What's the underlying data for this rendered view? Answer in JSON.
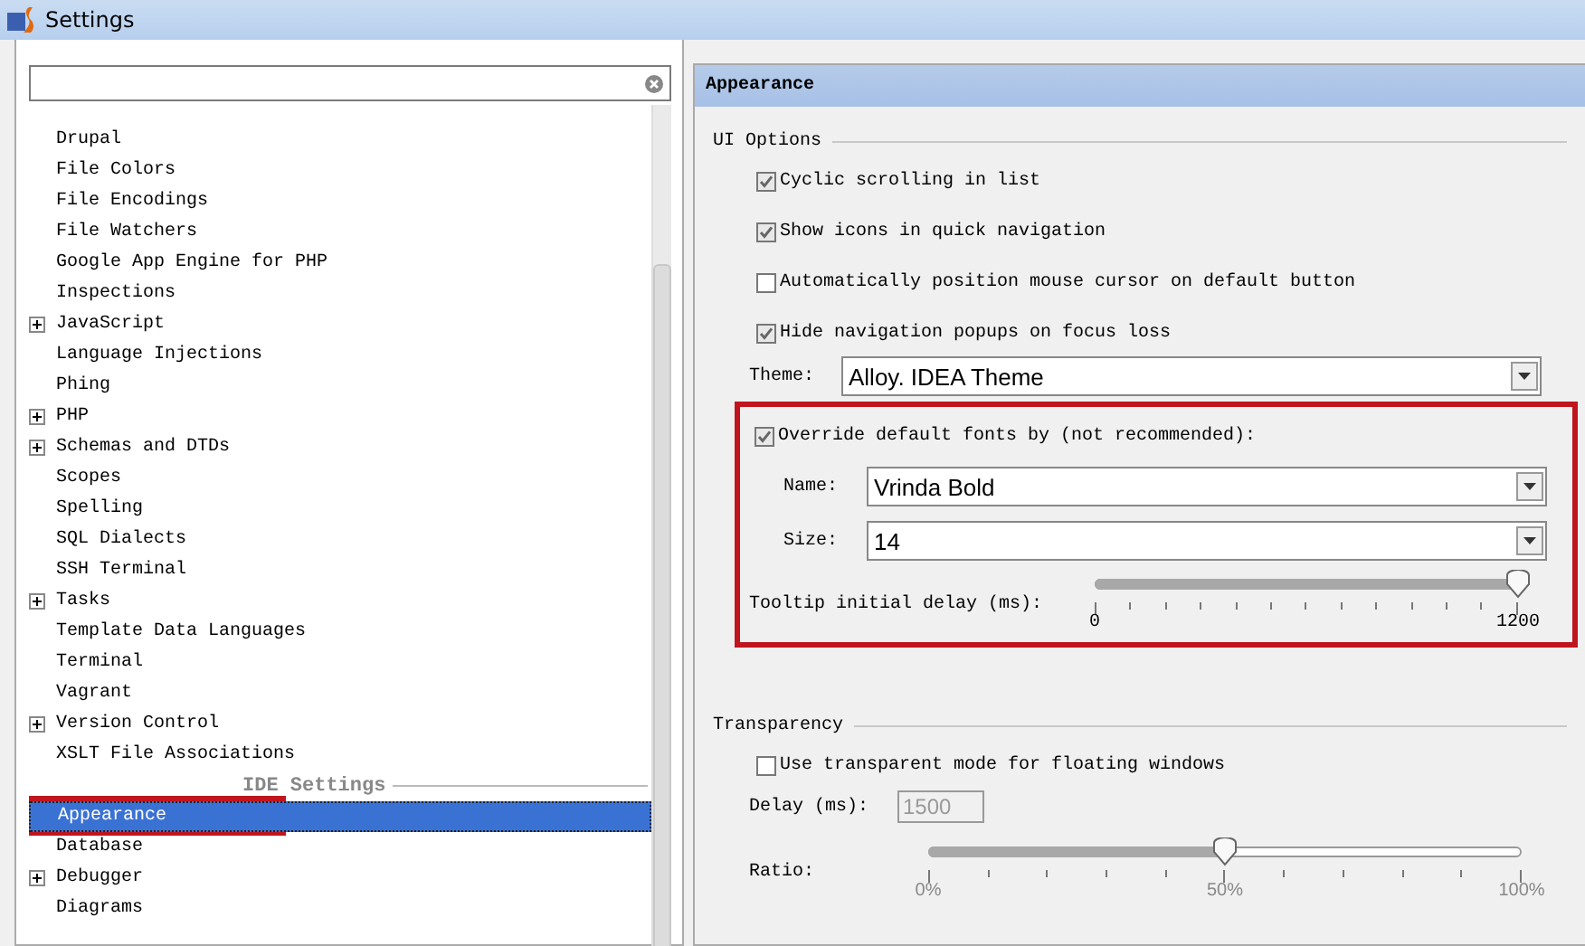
{
  "window": {
    "title": "Settings"
  },
  "tree": {
    "items": [
      {
        "kind": "leaf",
        "label": "Drupal",
        "selected": false
      },
      {
        "kind": "leaf",
        "label": "File Colors",
        "selected": false
      },
      {
        "kind": "leaf",
        "label": "File Encodings",
        "selected": false
      },
      {
        "kind": "leaf",
        "label": "File Watchers",
        "selected": false
      },
      {
        "kind": "leaf",
        "label": "Google App Engine for PHP",
        "selected": false
      },
      {
        "kind": "leaf",
        "label": "Inspections",
        "selected": false
      },
      {
        "kind": "group",
        "label": "JavaScript",
        "expanded": false,
        "selected": false
      },
      {
        "kind": "leaf",
        "label": "Language Injections",
        "selected": false
      },
      {
        "kind": "leaf",
        "label": "Phing",
        "selected": false
      },
      {
        "kind": "group",
        "label": "PHP",
        "expanded": false,
        "selected": false
      },
      {
        "kind": "group",
        "label": "Schemas and DTDs",
        "expanded": false,
        "selected": false
      },
      {
        "kind": "leaf",
        "label": "Scopes",
        "selected": false
      },
      {
        "kind": "leaf",
        "label": "Spelling",
        "selected": false
      },
      {
        "kind": "leaf",
        "label": "SQL Dialects",
        "selected": false
      },
      {
        "kind": "leaf",
        "label": "SSH Terminal",
        "selected": false
      },
      {
        "kind": "group",
        "label": "Tasks",
        "expanded": false,
        "selected": false
      },
      {
        "kind": "leaf",
        "label": "Template Data Languages",
        "selected": false
      },
      {
        "kind": "leaf",
        "label": "Terminal",
        "selected": false
      },
      {
        "kind": "leaf",
        "label": "Vagrant",
        "selected": false
      },
      {
        "kind": "group",
        "label": "Version Control",
        "expanded": false,
        "selected": false
      },
      {
        "kind": "leaf",
        "label": "XSLT File Associations",
        "selected": false
      },
      {
        "kind": "section",
        "label": "IDE Settings"
      },
      {
        "kind": "leaf",
        "label": "Appearance",
        "selected": true
      },
      {
        "kind": "leaf",
        "label": "Database",
        "selected": false
      },
      {
        "kind": "group",
        "label": "Debugger",
        "expanded": false,
        "selected": false
      },
      {
        "kind": "leaf",
        "label": "Diagrams",
        "selected": false
      }
    ]
  },
  "panel": {
    "title": "Appearance",
    "ui_options": {
      "title": "UI Options",
      "checkboxes": [
        {
          "label": "Cyclic scrolling in list",
          "checked": true
        },
        {
          "label": "Show icons in quick navigation",
          "checked": true
        },
        {
          "label": "Automatically position mouse cursor on default button",
          "checked": false
        },
        {
          "label": "Hide navigation popups on focus loss",
          "checked": true
        }
      ],
      "theme": {
        "label": "Theme:",
        "value": "Alloy. IDEA Theme"
      },
      "override": {
        "label": "Override default fonts by (not recommended):",
        "checked": true
      },
      "font_name": {
        "label": "Name:",
        "value": "Vrinda Bold"
      },
      "font_size": {
        "label": "Size:",
        "value": "14"
      },
      "tooltip_delay": {
        "label": "Tooltip initial delay (ms):",
        "level": 1,
        "tick_labels": [
          "0",
          "1200"
        ]
      }
    },
    "transparency": {
      "title": "Transparency",
      "checkbox": {
        "label": "Use transparent mode for floating windows",
        "checked": false
      },
      "delay": {
        "label": "Delay (ms):",
        "value": "1500",
        "disabled": true
      },
      "ratio": {
        "label": "Ratio:",
        "level": 0.5,
        "tick_labels": [
          "0%",
          "50%",
          "100%"
        ]
      }
    }
  }
}
